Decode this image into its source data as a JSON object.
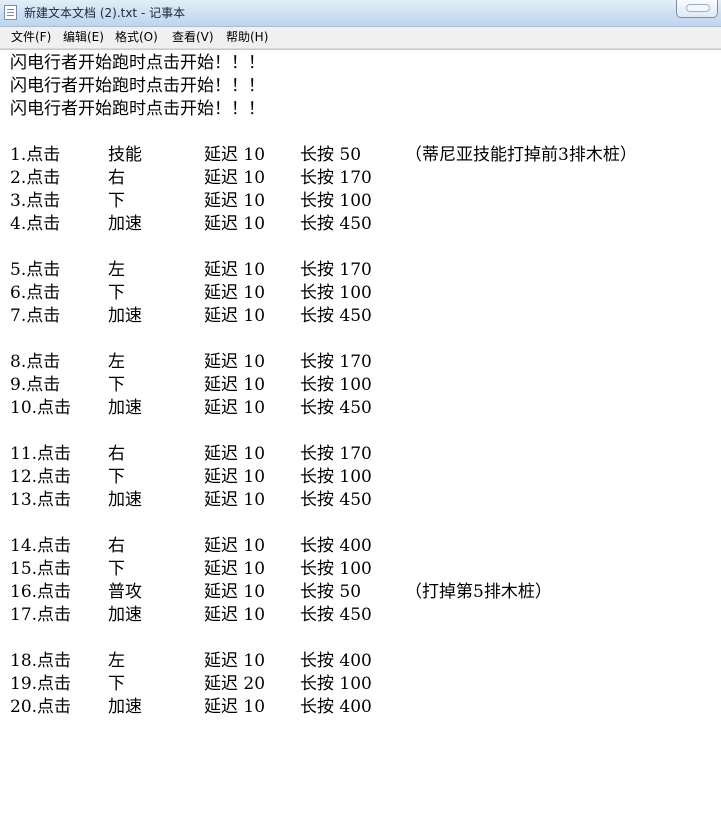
{
  "window": {
    "title": "新建文本文档 (2).txt - 记事本"
  },
  "menu": [
    {
      "label": "文件(F)"
    },
    {
      "label": "编辑(E)"
    },
    {
      "label": "格式(O)"
    },
    {
      "label": "查看(V)"
    },
    {
      "label": "帮助(H)"
    }
  ],
  "content": {
    "header_lines": [
      "闪电行者开始跑时点击开始！！！",
      "闪电行者开始跑时点击开始！！！",
      "闪电行者开始跑时点击开始！！！"
    ],
    "steps": [
      {
        "num": "1.点击",
        "action": "技能",
        "delay": "延迟 10",
        "hold": "长按 50",
        "note": "（蒂尼亚技能打掉前3排木桩）"
      },
      {
        "num": "2.点击",
        "action": "右",
        "delay": "延迟 10",
        "hold": "长按 170",
        "note": ""
      },
      {
        "num": "3.点击",
        "action": "下",
        "delay": "延迟 10",
        "hold": "长按 100",
        "note": ""
      },
      {
        "num": "4.点击",
        "action": "加速",
        "delay": "延迟 10",
        "hold": "长按 450",
        "note": ""
      },
      {
        "num": "5.点击",
        "action": "左",
        "delay": "延迟 10",
        "hold": "长按 170",
        "note": ""
      },
      {
        "num": "6.点击",
        "action": "下",
        "delay": "延迟 10",
        "hold": "长按 100",
        "note": ""
      },
      {
        "num": "7.点击",
        "action": "加速",
        "delay": "延迟 10",
        "hold": "长按 450",
        "note": ""
      },
      {
        "num": "8.点击",
        "action": "左",
        "delay": "延迟 10",
        "hold": "长按 170",
        "note": ""
      },
      {
        "num": "9.点击",
        "action": "下",
        "delay": "延迟 10",
        "hold": "长按 100",
        "note": ""
      },
      {
        "num": "10.点击",
        "action": "加速",
        "delay": "延迟 10",
        "hold": "长按 450",
        "note": ""
      },
      {
        "num": "11.点击",
        "action": "右",
        "delay": "延迟 10",
        "hold": "长按 170",
        "note": ""
      },
      {
        "num": "12.点击",
        "action": "下",
        "delay": "延迟 10",
        "hold": "长按 100",
        "note": ""
      },
      {
        "num": "13.点击",
        "action": "加速",
        "delay": "延迟 10",
        "hold": "长按 450",
        "note": ""
      },
      {
        "num": "14.点击",
        "action": "右",
        "delay": "延迟 10",
        "hold": "长按 400",
        "note": ""
      },
      {
        "num": "15.点击",
        "action": "下",
        "delay": "延迟 10",
        "hold": "长按 100",
        "note": ""
      },
      {
        "num": "16.点击",
        "action": "普攻",
        "delay": "延迟 10",
        "hold": "长按 50",
        "note": "（打掉第5排木桩）"
      },
      {
        "num": "17.点击",
        "action": "加速",
        "delay": "延迟 10",
        "hold": "长按 450",
        "note": ""
      },
      {
        "num": "18.点击",
        "action": "左",
        "delay": "延迟 10",
        "hold": "长按 400",
        "note": ""
      },
      {
        "num": "19.点击",
        "action": "下",
        "delay": "延迟 20",
        "hold": "长按 100",
        "note": ""
      },
      {
        "num": "20.点击",
        "action": "加速",
        "delay": "延迟 10",
        "hold": "长按 400",
        "note": ""
      }
    ]
  }
}
